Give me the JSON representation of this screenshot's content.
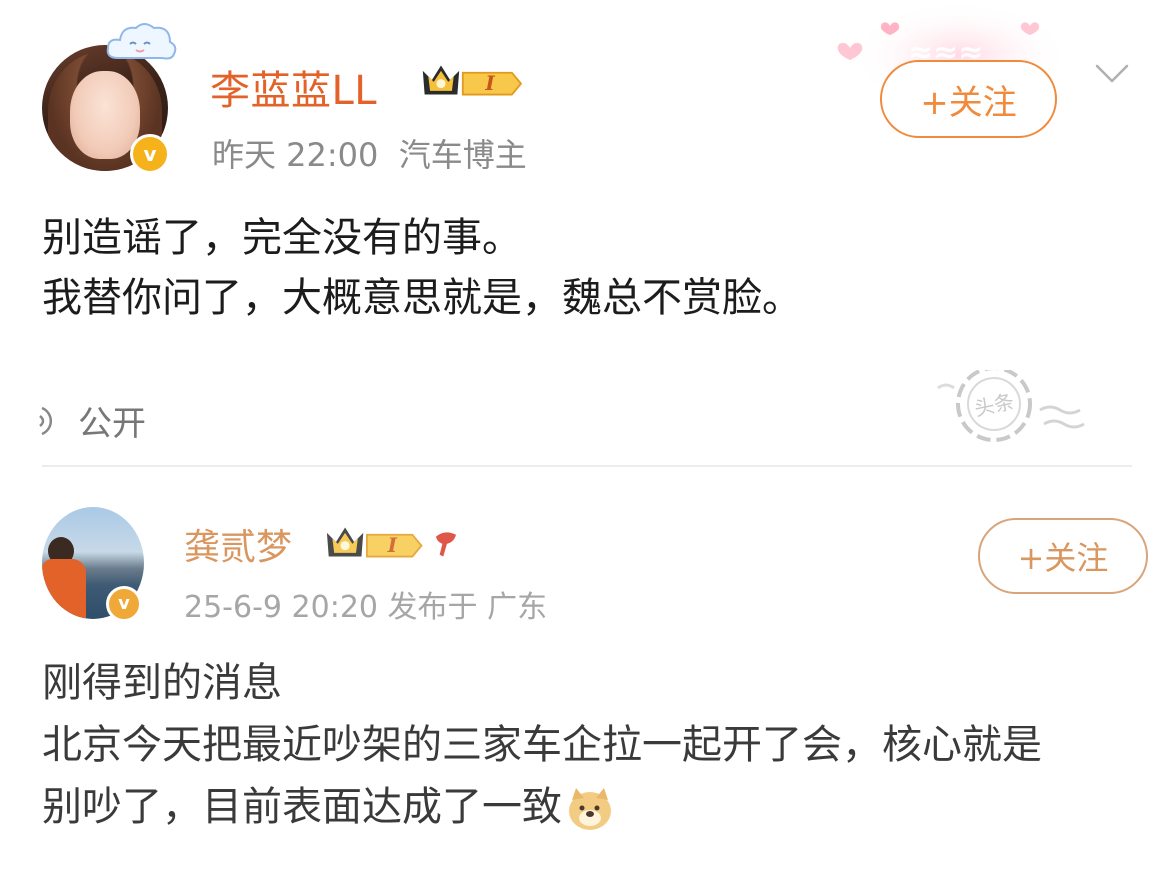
{
  "post1": {
    "author": "李蓝蓝LL",
    "level": "I",
    "time": "昨天 22:00",
    "tag": "汽车博主",
    "follow_label": "+关注",
    "lines": [
      "别造谣了，完全没有的事。",
      "我替你问了，大概意思就是，魏总不赏脸。"
    ],
    "visibility": "公开",
    "stamp_text": "头条"
  },
  "post2": {
    "author": "龚贰梦",
    "level": "I",
    "date": "25-6-9 20:20",
    "location": "发布于 广东",
    "follow_label": "+关注",
    "lines": [
      "刚得到的消息",
      "北京今天把最近吵架的三家车企拉一起开了会，核心就是",
      "别吵了，目前表面达成了一致"
    ]
  },
  "colors": {
    "accent_orange": "#e2622a",
    "follow_orange": "#f08a3c",
    "verify_gold": "#f6b21a"
  }
}
